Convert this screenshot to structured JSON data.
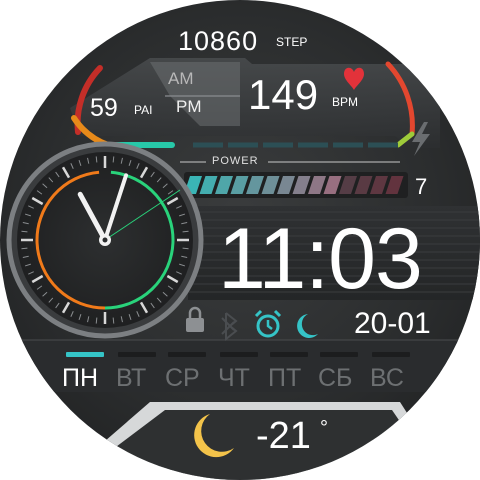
{
  "steps": {
    "value": "10860",
    "unit": "STEP"
  },
  "period": {
    "am": "AM",
    "pm": "PM"
  },
  "heart_rate": {
    "value": "149",
    "unit": "BPM"
  },
  "pai": {
    "value": "59",
    "unit": "PAI"
  },
  "power": {
    "label": "POWER",
    "value": "7",
    "level_fraction": 0.7
  },
  "time": {
    "display": "11:03"
  },
  "date": {
    "display": "20-01"
  },
  "days": {
    "items": [
      "ПН",
      "ВТ",
      "СР",
      "ЧТ",
      "ПТ",
      "СБ",
      "ВС"
    ],
    "active_index": 0
  },
  "status_icons": [
    "lock-icon",
    "bluetooth-icon",
    "alarm-icon",
    "moon-icon"
  ],
  "weather": {
    "temp": "-21",
    "degree": "°",
    "icon": "moon-icon"
  },
  "colors": {
    "accent_teal": "#35c4c7",
    "accent_orange": "#f07a1a",
    "accent_green": "#29d37b",
    "heart": "#e3323a",
    "moon": "#f3c34a"
  }
}
